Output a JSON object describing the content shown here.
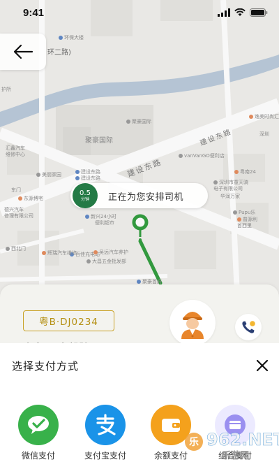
{
  "status_bar": {
    "time": "9:41"
  },
  "map": {
    "road_labels": [
      "建设东路",
      "建设东路"
    ],
    "area_label": "聚豪国际",
    "top_label": "环二路)",
    "pois": [
      "环保大楼",
      "护所",
      "聚豪国际",
      "逸美时尚汇",
      "深圳",
      "汇鑫汽车",
      "维修中心",
      "美丽家园",
      "建设东路",
      "建设东路",
      "vanVanGO便利店",
      "粤南24",
      "深圳市童天骑",
      "电子有限公司",
      "华润万家",
      "东门",
      "东源博宅",
      "Pupu乐",
      "普源利",
      "首西里",
      "德兴汽车",
      "修理有限公司",
      "新兴24小时",
      "便利超市",
      "西北门",
      "百佳充电站",
      "大昌五金批发部",
      "吴远汽车养护",
      "辉瑞汽车维修",
      "聚豪首府"
    ]
  },
  "driver_status": {
    "timer_value": "0.5",
    "timer_unit": "分钟",
    "message": "正在为您安排司机"
  },
  "trip": {
    "plate": "粤B·DJ0234",
    "subtext": "小多·王安驾驶"
  },
  "payment": {
    "title": "选择支付方式",
    "options": [
      {
        "label": "微信支付",
        "color": "#38b14a"
      },
      {
        "label": "支付宝支付",
        "color": "#1a93e8"
      },
      {
        "label": "余额支付",
        "color": "#f4a11c"
      },
      {
        "label": "组合支付",
        "color": "#9a8ff0"
      }
    ]
  },
  "watermark": {
    "text": "962.NET",
    "subtext": "乐游网"
  },
  "colors": {
    "accent_green": "#237a45",
    "route_green": "#2d9b3a",
    "plate_gold": "#c9a227"
  }
}
